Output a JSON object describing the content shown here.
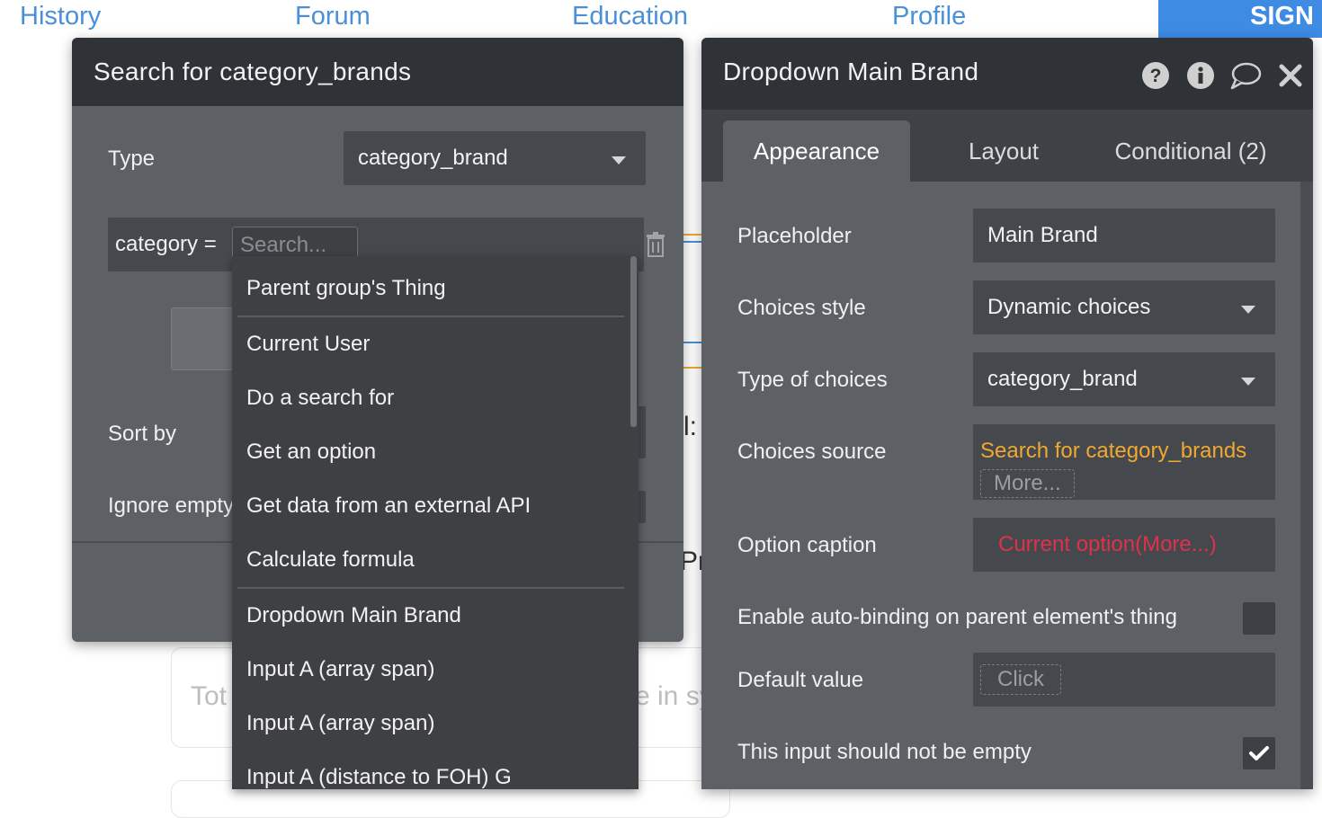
{
  "nav": {
    "history": "History",
    "forum": "Forum",
    "education": "Education",
    "profile": "Profile",
    "signup": "SIGN UP"
  },
  "background": {
    "partial_text_1": "l:",
    "partial_text_2": "Pr",
    "partial_text_3": "Tot",
    "partial_text_4": "e in sy"
  },
  "search_panel": {
    "title": "Search for category_brands",
    "type_label": "Type",
    "type_value": "category_brand",
    "constraint_label": "category =",
    "constraint_placeholder": "Search...",
    "sort_label": "Sort by",
    "ignore_label": "Ignore empty constraints"
  },
  "menu": {
    "items": [
      "Parent group's Thing",
      "Current User",
      "Do a search for",
      "Get an option",
      "Get data from an external API",
      "Calculate formula",
      "Dropdown Main Brand",
      "Input A (array span)",
      "Input A (array span)",
      "Input A (distance to FOH) G"
    ]
  },
  "element_panel": {
    "title": "Dropdown Main Brand",
    "tabs": [
      "Appearance",
      "Layout",
      "Conditional (2)"
    ],
    "placeholder_label": "Placeholder",
    "placeholder_value": "Main Brand",
    "choices_style_label": "Choices style",
    "choices_style_value": "Dynamic choices",
    "type_of_choices_label": "Type of choices",
    "type_of_choices_value": "category_brand",
    "choices_source_label": "Choices source",
    "choices_source_value": "Search for category_brands",
    "choices_source_more": "More...",
    "option_caption_label": "Option caption",
    "option_caption_value": "Current option(More...)",
    "autobinding_label": "Enable auto-binding on parent element's thing",
    "default_value_label": "Default value",
    "default_value_click": "Click",
    "not_empty_label": "This input should not be empty"
  },
  "colors": {
    "panel_bg": "#5d6166",
    "header_bg": "#2f3338",
    "field_bg": "#45494e",
    "source_orange": "#f0a830",
    "caption_red": "#e0314b",
    "link_blue": "#4a90d9"
  },
  "icons": {
    "help": "question-circle-icon",
    "info": "info-circle-icon",
    "comment": "speech-bubble-icon",
    "close": "close-icon",
    "delete": "trash-icon",
    "check": "checkmark-icon"
  }
}
